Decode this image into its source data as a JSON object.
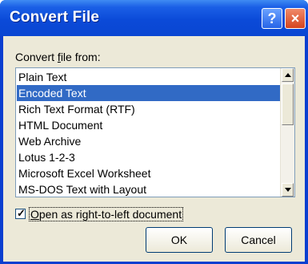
{
  "window": {
    "title": "Convert File",
    "help_label": "?",
    "close_label": "×"
  },
  "dialog": {
    "label_prefix": "Convert ",
    "label_accel": "f",
    "label_suffix": "ile from:",
    "items": [
      "Plain Text",
      "Encoded Text",
      "Rich Text Format (RTF)",
      "HTML Document",
      "Web Archive",
      "Lotus 1-2-3",
      "Microsoft Excel Worksheet",
      "MS-DOS Text with Layout"
    ],
    "selected_item": "Encoded Text",
    "checkbox": {
      "checked_mark": "✓",
      "label_accel": "O",
      "label_rest": "pen as right-to-left document"
    },
    "ok_label": "OK",
    "cancel_label": "Cancel"
  }
}
